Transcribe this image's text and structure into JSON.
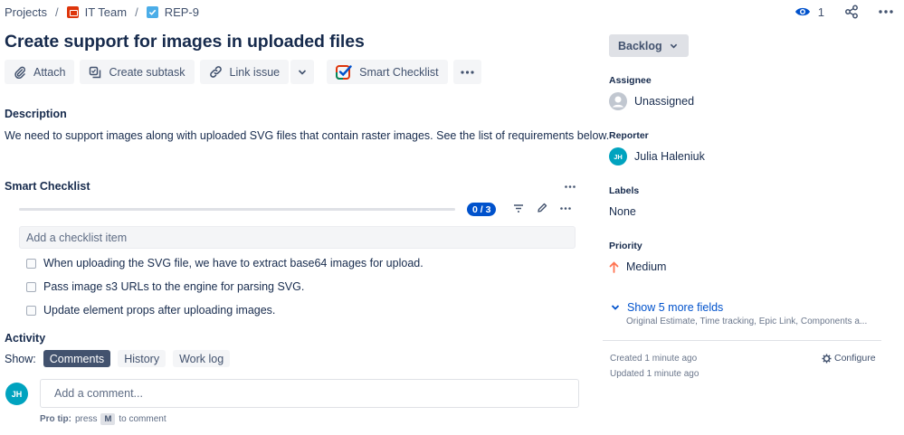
{
  "breadcrumbs": {
    "projects": "Projects",
    "separator": "/",
    "team": "IT Team",
    "issue_key": "REP-9"
  },
  "header": {
    "watch_count": "1"
  },
  "issue": {
    "title": "Create support for images in uploaded files"
  },
  "toolbar": {
    "attach": "Attach",
    "create_subtask": "Create subtask",
    "link_issue": "Link issue",
    "smart_checklist": "Smart Checklist"
  },
  "description": {
    "heading": "Description",
    "text": "We need to support images along with uploaded SVG files that contain raster images. See the list of requirements below."
  },
  "checklist": {
    "heading": "Smart Checklist",
    "progress": {
      "done": 0,
      "total": 3,
      "label": "0 / 3"
    },
    "add_placeholder": "Add a checklist item",
    "items": [
      {
        "text": "When uploading the SVG file, we have to extract base64 images for upload.",
        "checked": false
      },
      {
        "text": "Pass image s3 URLs to the engine for parsing SVG.",
        "checked": false
      },
      {
        "text": "Update element props after uploading images.",
        "checked": false
      }
    ]
  },
  "activity": {
    "heading": "Activity",
    "show_label": "Show:",
    "tabs": [
      {
        "label": "Comments",
        "active": true
      },
      {
        "label": "History",
        "active": false
      },
      {
        "label": "Work log",
        "active": false
      }
    ],
    "avatar_initials": "JH",
    "comment_placeholder": "Add a comment...",
    "protip_prefix": "Pro tip:",
    "protip_press": "press",
    "protip_key": "M",
    "protip_suffix": "to comment"
  },
  "sidebar": {
    "status": "Backlog",
    "assignee": {
      "label": "Assignee",
      "value": "Unassigned"
    },
    "reporter": {
      "label": "Reporter",
      "value": "Julia Haleniuk",
      "initials": "JH"
    },
    "labels": {
      "label": "Labels",
      "value": "None"
    },
    "priority": {
      "label": "Priority",
      "value": "Medium"
    },
    "more_fields": "Show 5 more fields",
    "more_fields_sub": "Original Estimate, Time tracking, Epic Link, Components a...",
    "created": "Created 1 minute ago",
    "updated": "Updated 1 minute ago",
    "configure": "Configure"
  },
  "colors": {
    "accent": "#0052cc",
    "text": "#172b4d",
    "subtle": "#42526e",
    "button_bg": "#f4f5f7",
    "priority_medium": "#ff7452",
    "avatar": "#00a3bf"
  },
  "icons": [
    "eye-icon",
    "share-icon",
    "more-icon",
    "attachment-icon",
    "subtask-icon",
    "link-icon",
    "chevron-down-icon",
    "checklist-logo-icon",
    "filter-icon",
    "edit-icon",
    "user-icon",
    "arrow-up-icon",
    "gear-icon"
  ]
}
